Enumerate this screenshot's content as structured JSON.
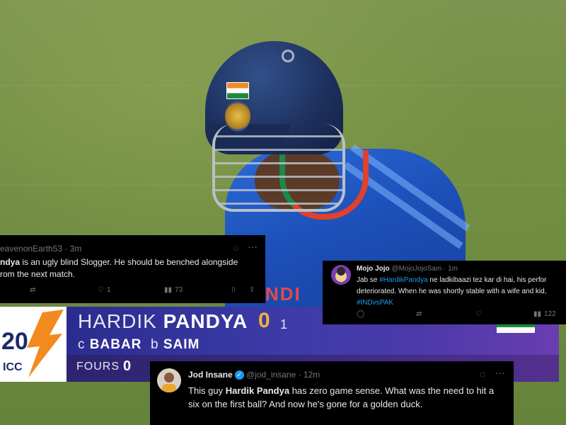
{
  "tweet1": {
    "handle": "eavenonEarth53 · 3m",
    "text_bold": "ndya",
    "text_line1": " is an ugly blind Slogger. He should be benched alongside",
    "text_line2": "rom the next match.",
    "likes": "1",
    "views": "73"
  },
  "tweet2": {
    "name": "Mojo Jojo",
    "handle": "@MojoJojoSam · 1m",
    "text_pre": "Jab se ",
    "hashtag1": "#HardikPandya",
    "text_post": " ne ladkibaazi tez kar di hai, his perfor",
    "text_line2": "deteriorated. When he was shortly stable with a wife and kid,",
    "hashtag2": "#INDvsPAK",
    "views": "122"
  },
  "tweet3": {
    "name": "Jod Insane",
    "handle": "@jod_insane · 12m",
    "text_pre": "This guy ",
    "text_bold": "Hardik Pandya",
    "text_post": " has zero game sense. What was the need to hit a",
    "text_line2": "six on the first ball? And now he's gone for a golden duck."
  },
  "scorecard": {
    "first_name": "HARDIK",
    "last_name": "PANDYA",
    "runs": "0",
    "balls": "1",
    "caught_prefix": "c",
    "caught_by": "BABAR",
    "bowled_prefix": "b",
    "bowled_by": "SAIM",
    "fours_label": "FOURS",
    "fours_value": "0",
    "logo_top": "20",
    "logo_bottom": "ICC"
  },
  "jersey_text": "NDI",
  "colors": {
    "tweet_bg": "#000000",
    "hashtag": "#1d9bf0",
    "runs": "#f2b23a",
    "score_bg": "#3c3ba8",
    "logo_orange": "#f28a1e"
  }
}
